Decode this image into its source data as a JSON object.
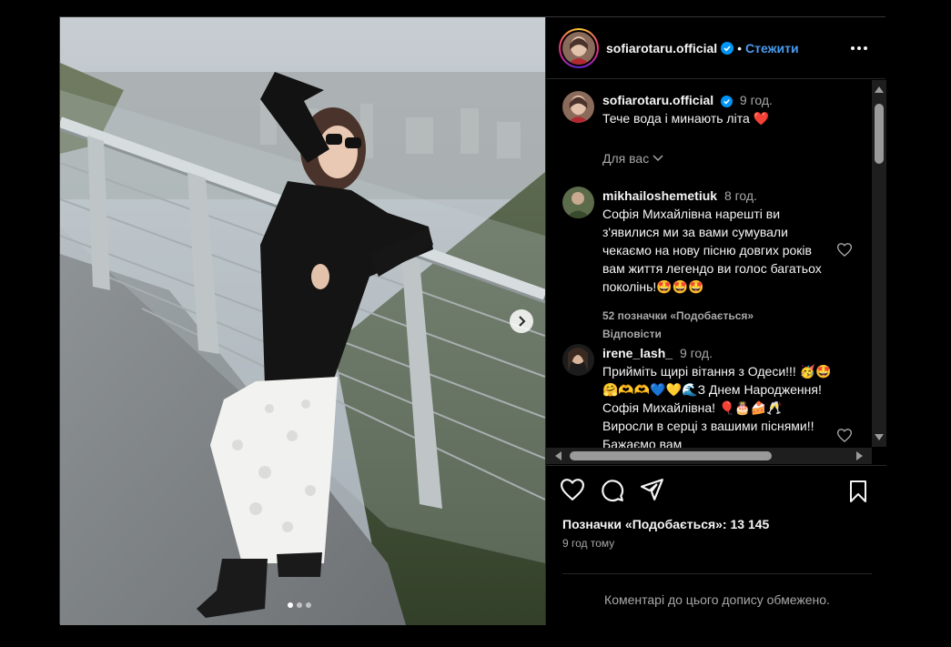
{
  "post": {
    "username": "sofiarotaru.official",
    "separator": "•",
    "follow_label": "Стежити",
    "caption_time": "9 год.",
    "caption": "Тече вода і минають літа ❤️",
    "sort_label": "Для вас",
    "likes_text": "Позначки «Подобається»: 13 145",
    "time_ago": "9 год тому",
    "comments_limited": "Коментарі до цього допису обмежено."
  },
  "comments": [
    {
      "username": "mikhailoshemetiuk",
      "time": "8 год.",
      "text": "Софія Михайлівна нарешті ви з'явилися ми за вами сумували чекаємо на нову пісню довгих років вам життя легендо ви голос багатьох поколінь!🤩🤩🤩",
      "likes": "52 позначки «Подобається»",
      "reply": "Відповісти"
    },
    {
      "username": "irene_lash_",
      "time": "9 год.",
      "text": "Прийміть щирі вітання з Одеси!!! 🥳🤩🤗🫶🫶💙💛🌊З Днем Народження! Софія Михайлівна! 🎈🎂🍰🥂 Виросли в серці з вашими піснями!! Бажаємо вам"
    }
  ],
  "carousel": {
    "slide": 1,
    "total": 3
  },
  "colors": {
    "accent": "#4a9cf0",
    "background": "#000000",
    "heart": "#ed4956"
  },
  "icons": [
    "verified-icon",
    "more-icon",
    "heart-icon",
    "comment-icon",
    "share-icon",
    "save-icon",
    "chevron-down-icon",
    "chevron-right-icon"
  ]
}
